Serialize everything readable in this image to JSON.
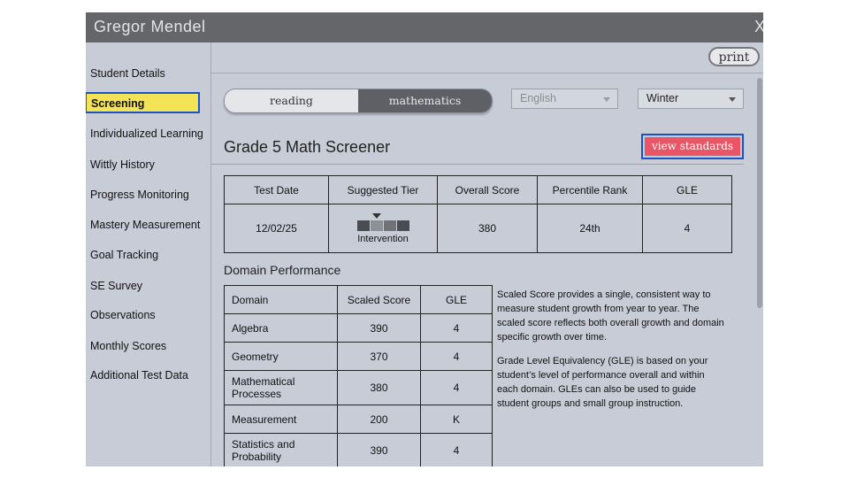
{
  "window": {
    "title": "Gregor Mendel",
    "close_label": "X"
  },
  "sidebar": {
    "items": [
      {
        "label": "Student Details"
      },
      {
        "label": "Screening",
        "active": true
      },
      {
        "label": "Individualized Learning"
      },
      {
        "label": "Wittly History"
      },
      {
        "label": "Progress Monitoring"
      },
      {
        "label": "Mastery Measurement"
      },
      {
        "label": "Goal Tracking"
      },
      {
        "label": "SE Survey"
      },
      {
        "label": "Observations"
      },
      {
        "label": "Monthly Scores"
      },
      {
        "label": "Additional Test Data"
      }
    ]
  },
  "toolbar": {
    "print_label": "print"
  },
  "subject_toggle": {
    "options": [
      "reading",
      "mathematics"
    ],
    "selected": "mathematics"
  },
  "language_select": {
    "value": "English",
    "disabled": true
  },
  "season_select": {
    "value": "Winter"
  },
  "page_title": "Grade 5 Math Screener",
  "view_standards_label": "view standards",
  "summary_table": {
    "headers": [
      "Test Date",
      "Suggested Tier",
      "Overall Score",
      "Percentile Rank",
      "GLE"
    ],
    "row": {
      "test_date": "12/02/25",
      "tier_label": "Intervention",
      "tier_level": 1,
      "tier_segments": 4,
      "overall_score": "380",
      "percentile_rank": "24th",
      "gle": "4"
    }
  },
  "domain_performance": {
    "heading": "Domain Performance",
    "headers": [
      "Domain",
      "Scaled Score",
      "GLE"
    ],
    "rows": [
      {
        "domain": "Algebra",
        "scaled_score": "390",
        "gle": "4"
      },
      {
        "domain": "Geometry",
        "scaled_score": "370",
        "gle": "4"
      },
      {
        "domain": "Mathematical Processes",
        "scaled_score": "380",
        "gle": "4"
      },
      {
        "domain": "Measurement",
        "scaled_score": "200",
        "gle": "K"
      },
      {
        "domain": "Statistics and Probability",
        "scaled_score": "390",
        "gle": "4"
      }
    ]
  },
  "info": {
    "scaled_score_text": "Scaled Score provides a single, consistent way to measure student growth from year to year. The scaled score reflects both overall growth and domain specific growth over time.",
    "gle_text": "Grade Level Equivalency (GLE) is based on your student’s level of performance overall and within each domain. GLEs can also be used to guide student groups and small group instruction."
  },
  "colors": {
    "active_highlight": "#f3e357",
    "focus_border": "#1c52c4",
    "view_standards_bg": "#ea5565",
    "titlebar": "#646669",
    "tier_segments": [
      "#4a4c51",
      "#8e9097",
      "#707278",
      "#4a4c51"
    ]
  }
}
